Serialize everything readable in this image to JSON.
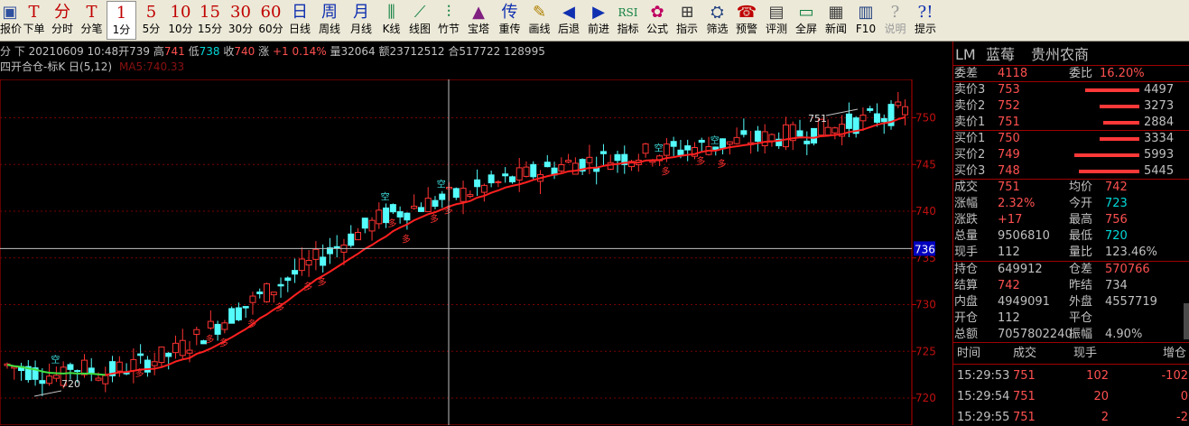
{
  "toolbar": [
    {
      "name": "price-button",
      "icon": "▣",
      "icon_color": "#3050a0",
      "label": "报价"
    },
    {
      "name": "order-button",
      "icon": "T",
      "icon_color": "#c00000",
      "label": "下单"
    },
    {
      "name": "timeshare-button",
      "icon": "分",
      "icon_color": "#c00000",
      "label": "分时"
    },
    {
      "name": "tick-button",
      "icon": "T",
      "icon_color": "#c00000",
      "label": "分笔"
    },
    {
      "name": "period-1min-button",
      "icon": "1",
      "icon_color": "#c00000",
      "label": "1分",
      "active": true
    },
    {
      "name": "period-5min-button",
      "icon": "5",
      "icon_color": "#c00000",
      "label": "5分"
    },
    {
      "name": "period-10min-button",
      "icon": "10",
      "icon_color": "#c00000",
      "label": "10分"
    },
    {
      "name": "period-15min-button",
      "icon": "15",
      "icon_color": "#c00000",
      "label": "15分"
    },
    {
      "name": "period-30min-button",
      "icon": "30",
      "icon_color": "#c00000",
      "label": "30分"
    },
    {
      "name": "period-60min-button",
      "icon": "60",
      "icon_color": "#c00000",
      "label": "60分"
    },
    {
      "name": "period-day-button",
      "icon": "日",
      "icon_color": "#1030b0",
      "label": "日线"
    },
    {
      "name": "period-week-button",
      "icon": "周",
      "icon_color": "#1030b0",
      "label": "周线"
    },
    {
      "name": "period-month-button",
      "icon": "月",
      "icon_color": "#1030b0",
      "label": "月线"
    },
    {
      "name": "kline-button",
      "icon": "⫼",
      "icon_color": "#108040",
      "label": "K线"
    },
    {
      "name": "line-chart-button",
      "icon": "⟋",
      "icon_color": "#108040",
      "label": "线图"
    },
    {
      "name": "bamboo-button",
      "icon": "⫶",
      "icon_color": "#108040",
      "label": "竹节"
    },
    {
      "name": "tower-button",
      "icon": "▲",
      "icon_color": "#802080",
      "label": "宝塔"
    },
    {
      "name": "overlay-button",
      "icon": "传",
      "icon_color": "#1030b0",
      "label": "重传"
    },
    {
      "name": "draw-line-button",
      "icon": "✎",
      "icon_color": "#b08000",
      "label": "画线"
    },
    {
      "name": "back-button",
      "icon": "◀",
      "icon_color": "#1030b0",
      "label": "后退"
    },
    {
      "name": "forward-button",
      "icon": "▶",
      "icon_color": "#1030b0",
      "label": "前进"
    },
    {
      "name": "indicator-button",
      "icon": "RSI",
      "icon_color": "#108040",
      "label": "指标"
    },
    {
      "name": "formula-button",
      "icon": "✿",
      "icon_color": "#c00060",
      "label": "公式"
    },
    {
      "name": "guide-button",
      "icon": "⊞",
      "icon_color": "#404040",
      "label": "指示"
    },
    {
      "name": "filter-button",
      "icon": "⛭",
      "icon_color": "#204080",
      "label": "筛选"
    },
    {
      "name": "alert-button",
      "icon": "☎",
      "icon_color": "#c00000",
      "label": "预警"
    },
    {
      "name": "evaluate-button",
      "icon": "▤",
      "icon_color": "#404040",
      "label": "评测"
    },
    {
      "name": "fullscreen-button",
      "icon": "▭",
      "icon_color": "#108040",
      "label": "全屏"
    },
    {
      "name": "news-button",
      "icon": "▦",
      "icon_color": "#404040",
      "label": "新闻"
    },
    {
      "name": "f10-button",
      "icon": "▥",
      "icon_color": "#204080",
      "label": "F10"
    },
    {
      "name": "explain-button",
      "icon": "?",
      "icon_color": "#9a9a9a",
      "label": "说明",
      "disabled": true
    },
    {
      "name": "help-button",
      "icon": "?!",
      "icon_color": "#1030b0",
      "label": "提示"
    }
  ],
  "infoline": {
    "prefix": "分 下",
    "datetime": "20210609 10:48",
    "open_label": "开",
    "open": "739",
    "high_label": "高",
    "high": "741",
    "low_label": "低",
    "low": "738",
    "close_label": "收",
    "close": "740",
    "change_label": "涨",
    "change": "+1 0.14%",
    "volume_label": "量",
    "volume": "32064",
    "amount_label": "额",
    "amount": "23712512",
    "oi_label": "合",
    "oi": "517722 128995"
  },
  "indicator": {
    "name": "四开合仓-标K 日(5,12)",
    "overlay_text": "MA5:740.33"
  },
  "chart_data": {
    "type": "candlestick",
    "ylim": [
      719,
      753
    ],
    "yticks": [
      720,
      725,
      730,
      735,
      740,
      745,
      750
    ],
    "crosshair_label": "736",
    "high_label": "751",
    "low_label": "720",
    "signals": {
      "buy": "多",
      "sell": "空"
    },
    "colors": {
      "up": "#ff3232",
      "down": "#54fcfc",
      "ma": "#ff2020",
      "ma_down": "#40e040",
      "grid": "#7a0000",
      "axis": "#c00000"
    }
  },
  "quote": {
    "symbol": "LM",
    "name": "蓝莓",
    "region": "贵州农商",
    "weicha_label": "委差",
    "weicha": "4118",
    "weibi_label": "委比",
    "weibi": "16.20%",
    "asks": [
      {
        "label": "卖价3",
        "price": "753",
        "vol": "4497"
      },
      {
        "label": "卖价2",
        "price": "752",
        "vol": "3273"
      },
      {
        "label": "卖价1",
        "price": "751",
        "vol": "2884"
      }
    ],
    "bids": [
      {
        "label": "买价1",
        "price": "750",
        "vol": "3334"
      },
      {
        "label": "买价2",
        "price": "749",
        "vol": "5993"
      },
      {
        "label": "买价3",
        "price": "748",
        "vol": "5445"
      }
    ],
    "stats": [
      [
        {
          "l": "成交",
          "v": "751",
          "c": "red"
        },
        {
          "l": "均价",
          "v": "742",
          "c": "red"
        }
      ],
      [
        {
          "l": "涨幅",
          "v": "2.32%",
          "c": "red"
        },
        {
          "l": "今开",
          "v": "723",
          "c": "cyan"
        }
      ],
      [
        {
          "l": "涨跌",
          "v": "+17",
          "c": "red"
        },
        {
          "l": "最高",
          "v": "756",
          "c": "red"
        }
      ],
      [
        {
          "l": "总量",
          "v": "9506810",
          "c": "grey"
        },
        {
          "l": "最低",
          "v": "720",
          "c": "cyan"
        }
      ],
      [
        {
          "l": "现手",
          "v": "112",
          "c": "grey"
        },
        {
          "l": "量比",
          "v": "123.46%",
          "c": "grey"
        }
      ]
    ],
    "stats2": [
      [
        {
          "l": "持仓",
          "v": "649912",
          "c": "grey"
        },
        {
          "l": "仓差",
          "v": "570766",
          "c": "red"
        }
      ],
      [
        {
          "l": "结算",
          "v": "742",
          "c": "red"
        },
        {
          "l": "昨结",
          "v": "734",
          "c": "grey"
        }
      ],
      [
        {
          "l": "内盘",
          "v": "4949091",
          "c": "grey"
        },
        {
          "l": "外盘",
          "v": "4557719",
          "c": "grey"
        }
      ],
      [
        {
          "l": "开仓",
          "v": "112",
          "c": "grey"
        },
        {
          "l": "平仓",
          "v": "",
          "c": "grey"
        }
      ],
      [
        {
          "l": "总额",
          "v": "7057802240",
          "c": "grey"
        },
        {
          "l": "振幅",
          "v": "4.90%",
          "c": "grey"
        }
      ]
    ]
  },
  "trades": {
    "headers": [
      "时间",
      "成交",
      "现手",
      "增仓"
    ],
    "rows": [
      {
        "time": "15:29:53",
        "price": "751",
        "vol": "102",
        "delta": "-102"
      },
      {
        "time": "15:29:54",
        "price": "751",
        "vol": "20",
        "delta": "0"
      },
      {
        "time": "15:29:55",
        "price": "751",
        "vol": "2",
        "delta": "-2"
      }
    ]
  }
}
